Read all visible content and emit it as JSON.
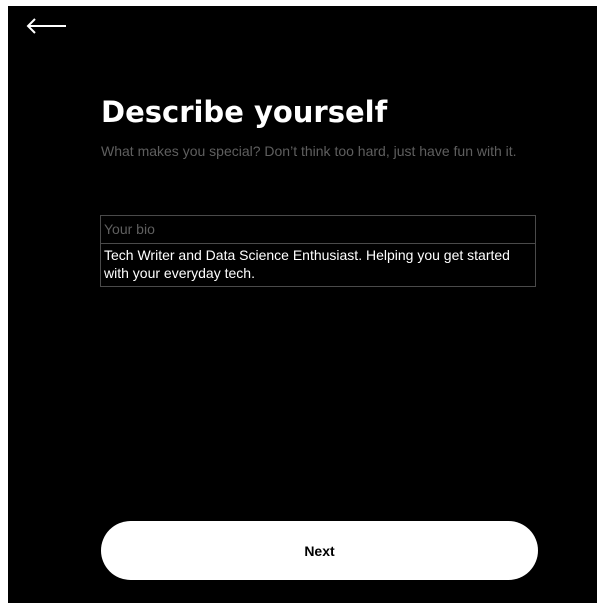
{
  "header": {
    "back_icon": "arrow-left-icon"
  },
  "main": {
    "title": "Describe yourself",
    "subtitle": "What makes you special? Don’t think too hard, just have fun with it.",
    "bio": {
      "label": "Your bio",
      "value": "Tech Writer and Data Science Enthusiast. Helping you get started with your everyday tech."
    },
    "next_label": "Next"
  },
  "colors": {
    "background": "#000000",
    "text": "#ffffff",
    "muted_text": "#5f5f5f",
    "field_border": "#4a4a4a",
    "button_bg": "#ffffff",
    "button_text": "#000000"
  }
}
